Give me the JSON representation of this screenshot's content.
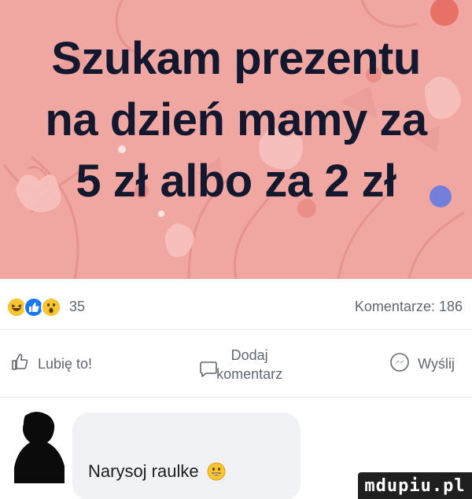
{
  "post": {
    "title_lines": [
      "Szukam prezentu",
      "na dzień mamy za",
      "5 zł albo za 2 zł"
    ]
  },
  "stats": {
    "reactions": [
      "haha",
      "like",
      "wow"
    ],
    "reaction_count": "35",
    "comments_label": "Komentarze: 186"
  },
  "actions": {
    "like_label": "Lubię to!",
    "comment_label_line1": "Dodaj",
    "comment_label_line2": "komentarz",
    "share_label": "Wyślij"
  },
  "comment": {
    "text": "Narysoj raulke"
  },
  "watermark": {
    "text": "mdupiu.pl"
  },
  "colors": {
    "image_bg": "#f0a7a2",
    "title": "#14182f",
    "like_blue": "#1877f2",
    "emoji_yellow": "#f7c531"
  }
}
